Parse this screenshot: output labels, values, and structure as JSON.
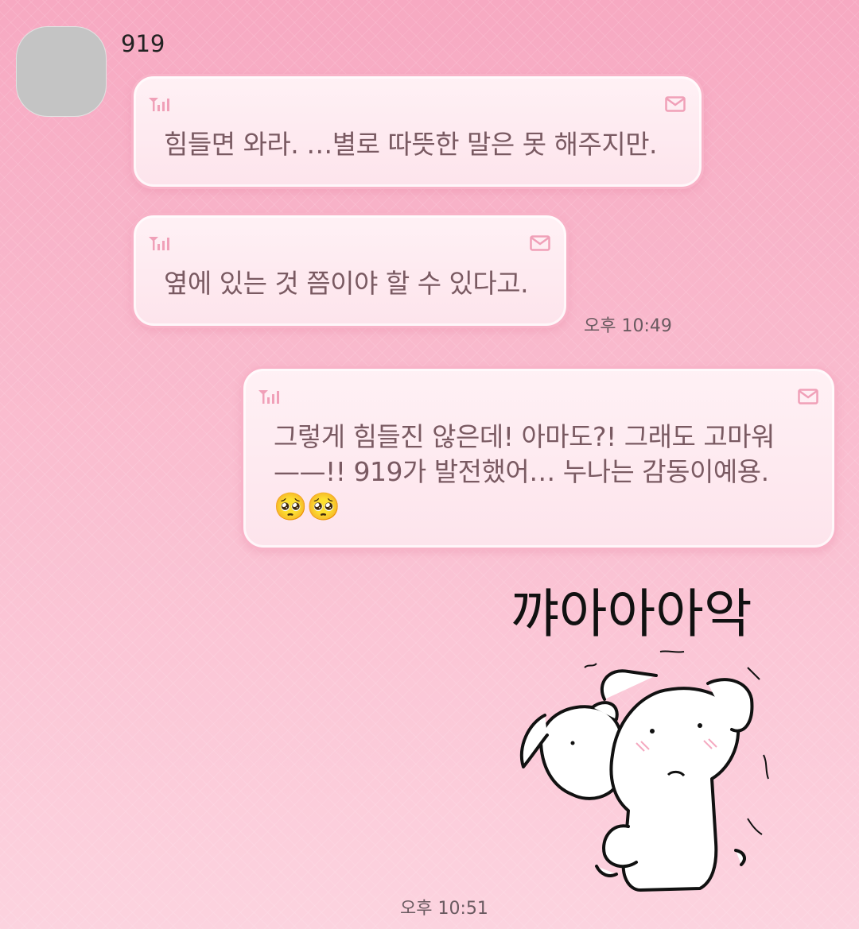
{
  "chat": {
    "sender_name": "919",
    "messages": [
      {
        "from": "919",
        "text": "힘들면 와라. …별로 따뜻한 말은 못 해주지만."
      },
      {
        "from": "919",
        "text": "옆에 있는 것 쯤이야 할 수 있다고.",
        "time": "오후 10:49"
      },
      {
        "from": "me",
        "text": "그렇게 힘들진 않은데! 아마도?! 그래도 고마워\n——!! 919가 발전했어… 누나는 감동이예용.",
        "emoji": "🥺🥺"
      }
    ],
    "sticker": {
      "text": "꺄아아아악",
      "time": "오후 10:51"
    }
  },
  "icons": {
    "signal": "signal-bars-icon",
    "mail": "envelope-icon"
  },
  "colors": {
    "background": "#f9b8cc",
    "bubble": "#fde4ec",
    "bubble_border": "#f8b3c8",
    "text": "#7a5a62"
  }
}
